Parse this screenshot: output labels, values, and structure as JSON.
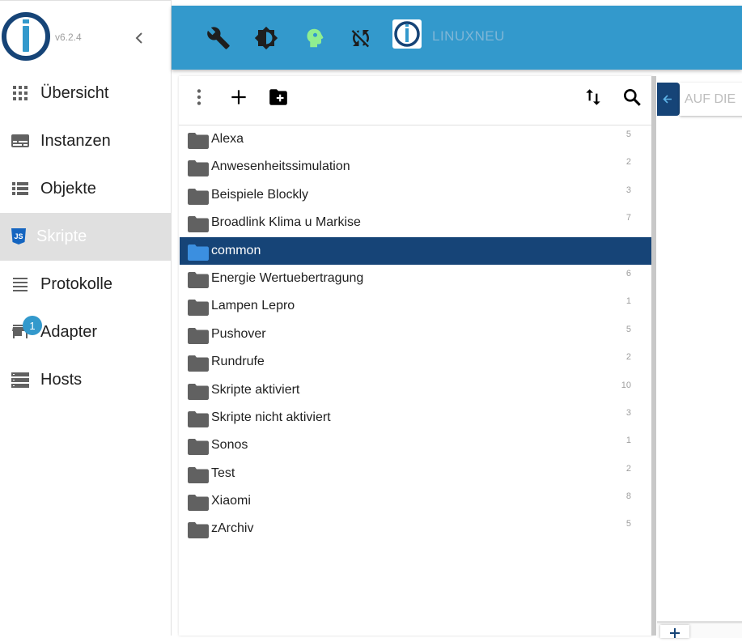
{
  "app": {
    "version": "v6.2.4",
    "host_name": "LINUXNEU"
  },
  "sidebar": {
    "items": [
      {
        "label": "Übersicht",
        "icon": "grid-icon",
        "active": false
      },
      {
        "label": "Instanzen",
        "icon": "instances-icon",
        "active": false
      },
      {
        "label": "Objekte",
        "icon": "list-view-icon",
        "active": false
      },
      {
        "label": "Skripte",
        "icon": "javascript-icon",
        "active": true
      },
      {
        "label": "Protokolle",
        "icon": "lines-icon",
        "active": false
      },
      {
        "label": "Adapter",
        "icon": "store-icon",
        "active": false,
        "badge": "1"
      },
      {
        "label": "Hosts",
        "icon": "servers-icon",
        "active": false
      }
    ]
  },
  "topbar": {
    "icons": [
      "wrench-icon",
      "brightness-icon",
      "expert-mode-icon",
      "sync-disabled-icon"
    ]
  },
  "scripts": {
    "toolbar": [
      "more-vert-icon",
      "add-icon",
      "create-folder-icon",
      "sort-icon",
      "search-icon"
    ],
    "folders": [
      {
        "name": "Alexa",
        "count": "5"
      },
      {
        "name": "Anwesenheitssimulation",
        "count": "2"
      },
      {
        "name": "Beispiele Blockly",
        "count": "3"
      },
      {
        "name": "Broadlink Klima u Markise",
        "count": "7"
      },
      {
        "name": "common",
        "count": "",
        "selected": true
      },
      {
        "name": "Energie Wertuebertragung",
        "count": "6"
      },
      {
        "name": "Lampen Lepro",
        "count": "1"
      },
      {
        "name": "Pushover",
        "count": "5"
      },
      {
        "name": "Rundrufe",
        "count": "2"
      },
      {
        "name": "Skripte aktiviert",
        "count": "10"
      },
      {
        "name": "Skripte nicht aktiviert",
        "count": "3"
      },
      {
        "name": "Sonos",
        "count": "1"
      },
      {
        "name": "Test",
        "count": "2"
      },
      {
        "name": "Xiaomi",
        "count": "8"
      },
      {
        "name": "zArchiv",
        "count": "5"
      }
    ]
  },
  "editor": {
    "tab_label": "AUF DIE"
  },
  "colors": {
    "primary": "#3399cc",
    "selected": "#164477",
    "folder": "#616161",
    "folder_selected": "#3b8fe0"
  }
}
